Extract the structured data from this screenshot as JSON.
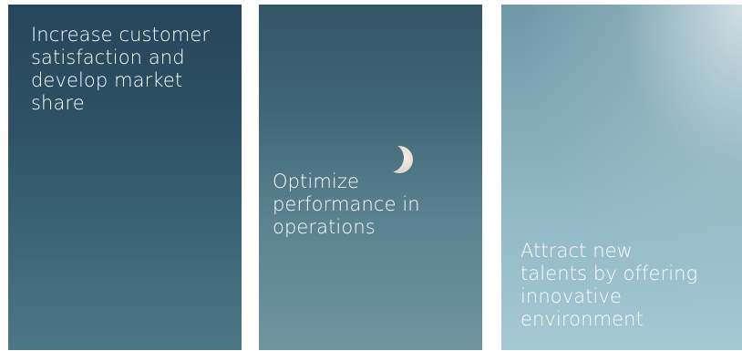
{
  "panels": [
    {
      "text": "Increase customer\nsatisfaction and\ndevelop market\nshare"
    },
    {
      "text": "Optimize\nperformance in\noperations"
    },
    {
      "text": "Attract new\ntalents by offering\ninnovative\nenvironment"
    }
  ],
  "icons": {
    "moon": "crescent-moon-icon"
  },
  "colors": {
    "text": "#ffffff",
    "panel_1_top": "#26455b",
    "panel_2_mid": "#5a8290",
    "panel_3_bottom": "#a5c8d5"
  }
}
